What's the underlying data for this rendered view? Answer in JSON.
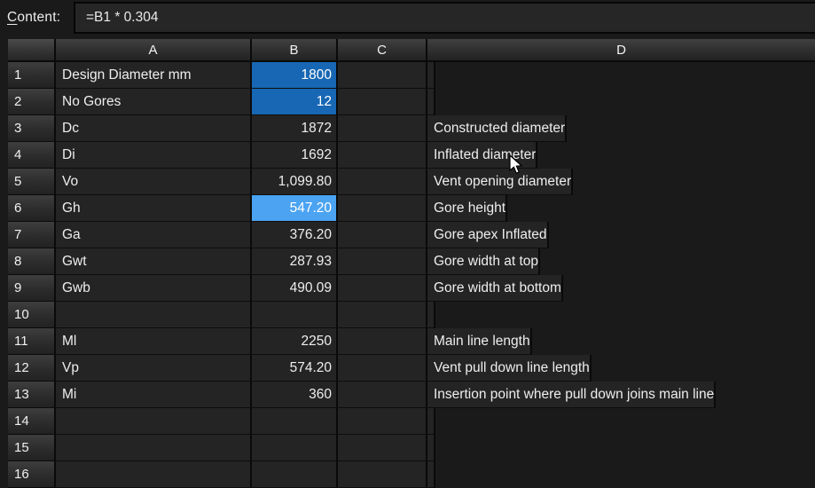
{
  "formula_bar": {
    "label_accel": "C",
    "label_rest": "ontent:",
    "value": "=B1 * 0.304"
  },
  "colors": {
    "selection_fill": "#1767b4",
    "active_cell_fill": "#4ba3f2",
    "cell_background": "#242424",
    "page_background": "#1a1a1a",
    "header_top": "#414141",
    "gridline": "#0a0a0a",
    "text": "#eeeeee"
  },
  "sheet": {
    "columns": [
      "A",
      "B",
      "C",
      "D"
    ],
    "rows": [
      {
        "num": "1",
        "A": "Design Diameter mm",
        "B": "1800",
        "C": "",
        "D": "",
        "b_state": "selected"
      },
      {
        "num": "2",
        "A": "No Gores",
        "B": "12",
        "C": "",
        "D": "",
        "b_state": "selected"
      },
      {
        "num": "3",
        "A": "Dc",
        "B": "1872",
        "C": "",
        "D": "Constructed diameter",
        "b_state": "none"
      },
      {
        "num": "4",
        "A": "Di",
        "B": "1692",
        "C": "",
        "D": "Inflated diameter",
        "b_state": "none"
      },
      {
        "num": "5",
        "A": "Vo",
        "B": "1,099.80",
        "C": "",
        "D": "Vent opening diameter",
        "b_state": "none"
      },
      {
        "num": "6",
        "A": "Gh",
        "B": "547.20",
        "C": "",
        "D": "Gore height",
        "b_state": "active"
      },
      {
        "num": "7",
        "A": "Ga",
        "B": "376.20",
        "C": "",
        "D": "Gore apex Inflated",
        "b_state": "none"
      },
      {
        "num": "8",
        "A": "Gwt",
        "B": "287.93",
        "C": "",
        "D": "Gore width at top",
        "b_state": "none"
      },
      {
        "num": "9",
        "A": "Gwb",
        "B": "490.09",
        "C": "",
        "D": "Gore width at bottom",
        "b_state": "none"
      },
      {
        "num": "10",
        "A": "",
        "B": "",
        "C": "",
        "D": "",
        "b_state": "none"
      },
      {
        "num": "11",
        "A": "Ml",
        "B": "2250",
        "C": "",
        "D": "Main line length",
        "b_state": "none"
      },
      {
        "num": "12",
        "A": "Vp",
        "B": "574.20",
        "C": "",
        "D": "Vent pull down line length",
        "b_state": "none"
      },
      {
        "num": "13",
        "A": "Mi",
        "B": "360",
        "C": "",
        "D": "Insertion point where pull down joins main line",
        "b_state": "none"
      },
      {
        "num": "14",
        "A": "",
        "B": "",
        "C": "",
        "D": "",
        "b_state": "none"
      },
      {
        "num": "15",
        "A": "",
        "B": "",
        "C": "",
        "D": "",
        "b_state": "none"
      },
      {
        "num": "16",
        "A": "",
        "B": "",
        "C": "",
        "D": "",
        "b_state": "none"
      }
    ]
  }
}
